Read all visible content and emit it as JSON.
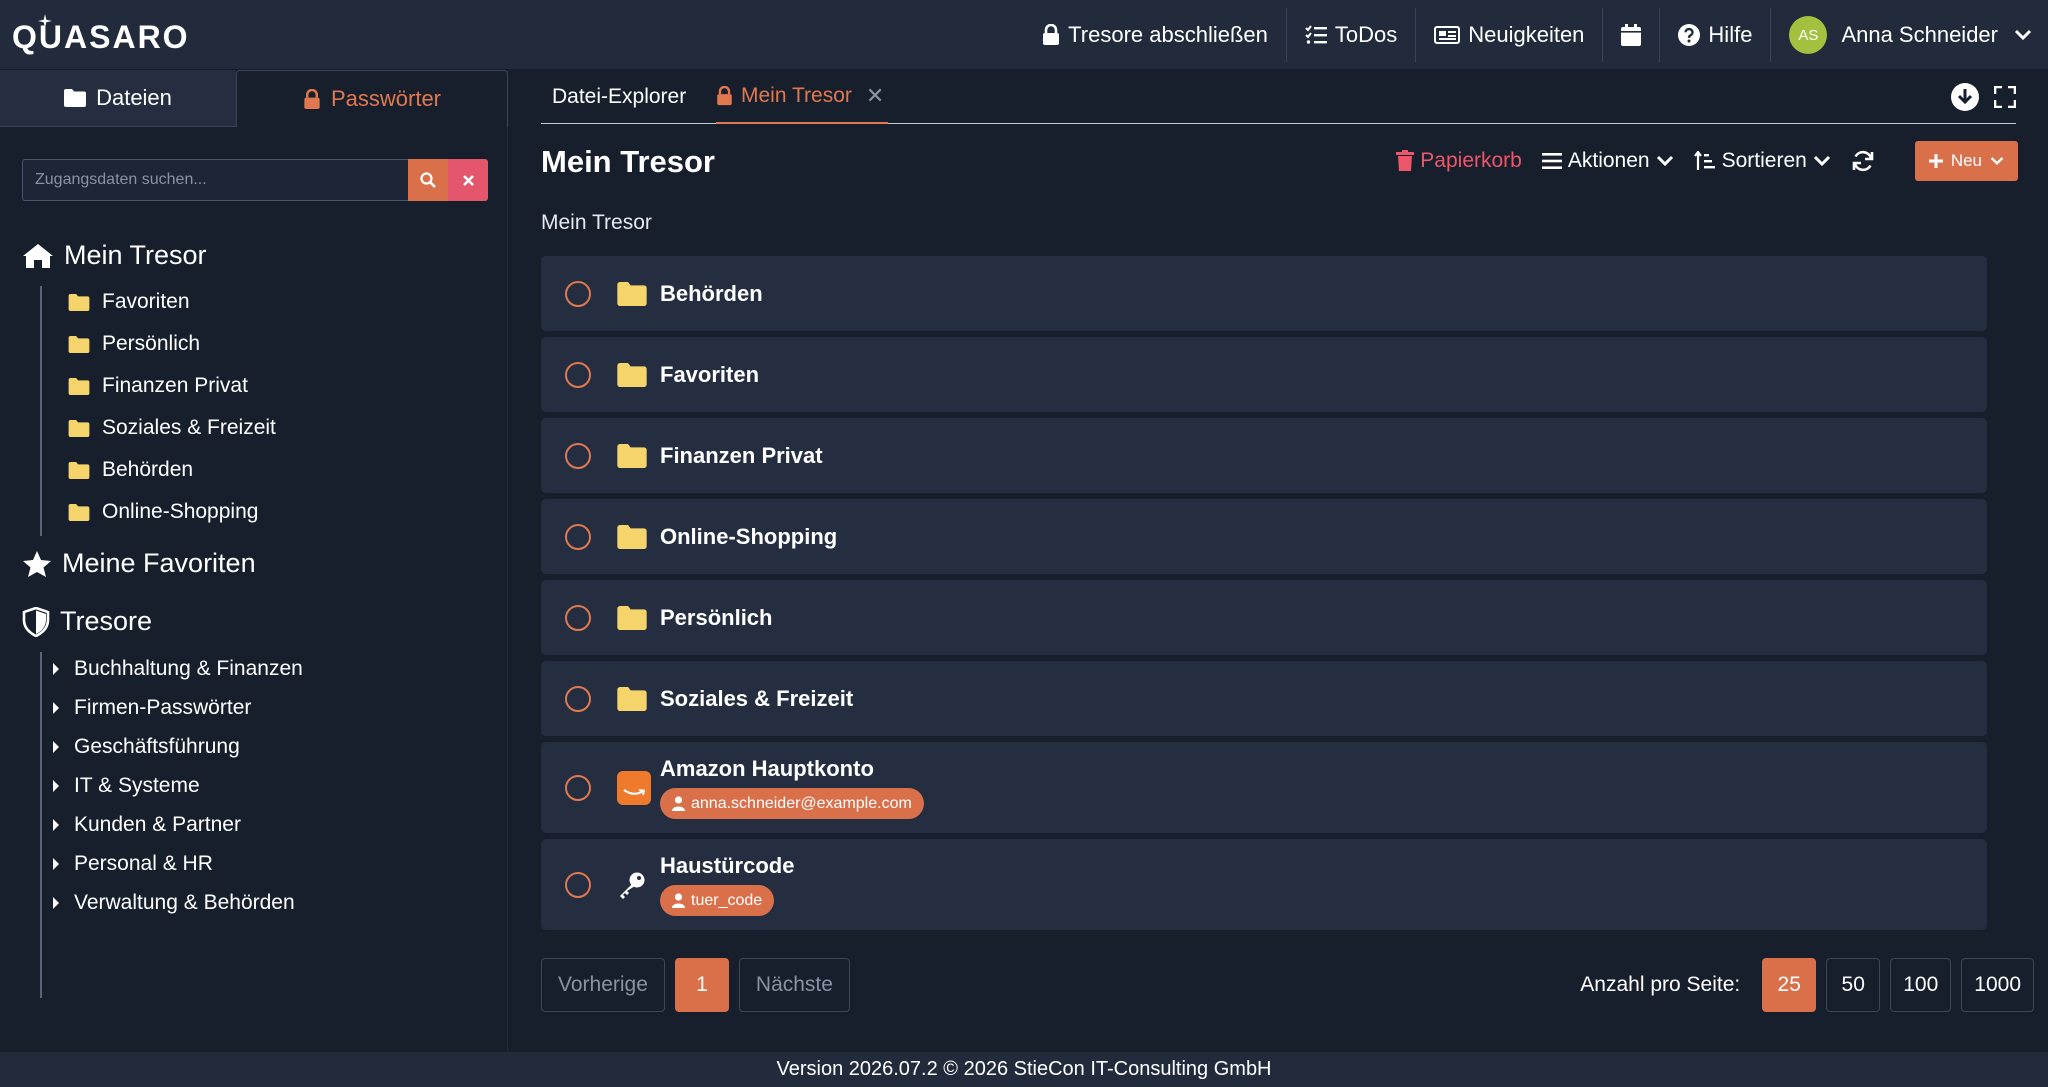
{
  "app": {
    "logo_text": "QUASARO"
  },
  "topnav": {
    "lock_vaults": "Tresore abschließen",
    "todos": "ToDos",
    "news": "Neuigkeiten",
    "help": "Hilfe",
    "user_initials": "AS",
    "user_name": "Anna Schneider"
  },
  "sidebar": {
    "tabs": {
      "files": "Dateien",
      "passwords": "Passwörter"
    },
    "search": {
      "placeholder": "Zugangsdaten suchen...",
      "value": ""
    },
    "my_vault": {
      "title": "Mein Tresor",
      "folders": [
        "Favoriten",
        "Persönlich",
        "Finanzen Privat",
        "Soziales & Freizeit",
        "Behörden",
        "Online-Shopping"
      ]
    },
    "my_favorites": "Meine Favoriten",
    "vaults": {
      "title": "Tresore",
      "items": [
        "Buchhaltung & Finanzen",
        "Firmen-Passwörter",
        "Geschäftsführung",
        "IT & Systeme",
        "Kunden & Partner",
        "Personal & HR",
        "Verwaltung & Behörden"
      ]
    }
  },
  "main": {
    "tabs": {
      "explorer": "Datei-Explorer",
      "vault": "Mein Tresor",
      "close": "✕"
    },
    "title": "Mein Tresor",
    "breadcrumb": "Mein Tresor",
    "toolbar": {
      "trash": "Papierkorb",
      "actions": "Aktionen",
      "sort": "Sortieren",
      "new": "Neu"
    },
    "folders": [
      "Behörden",
      "Favoriten",
      "Finanzen Privat",
      "Online-Shopping",
      "Persönlich",
      "Soziales & Freizeit"
    ],
    "entries": [
      {
        "name": "Amazon Hauptkonto",
        "username": "anna.schneider@example.com",
        "icon": "amazon-icon"
      },
      {
        "name": "Haustürcode",
        "username": "tuer_code",
        "icon": "key-icon"
      }
    ],
    "pagination": {
      "prev": "Vorherige",
      "current": "1",
      "next": "Nächste"
    },
    "per_page": {
      "label": "Anzahl pro Seite:",
      "options": [
        "25",
        "50",
        "100",
        "1000"
      ],
      "selected": "25"
    }
  },
  "footer": "Version 2026.07.2 © 2026 StieCon IT-Consulting GmbH",
  "colors": {
    "accent": "#d9704a",
    "danger": "#ec5769",
    "folder": "#f5d46b",
    "background": "#171e2c",
    "card": "#252e40"
  }
}
